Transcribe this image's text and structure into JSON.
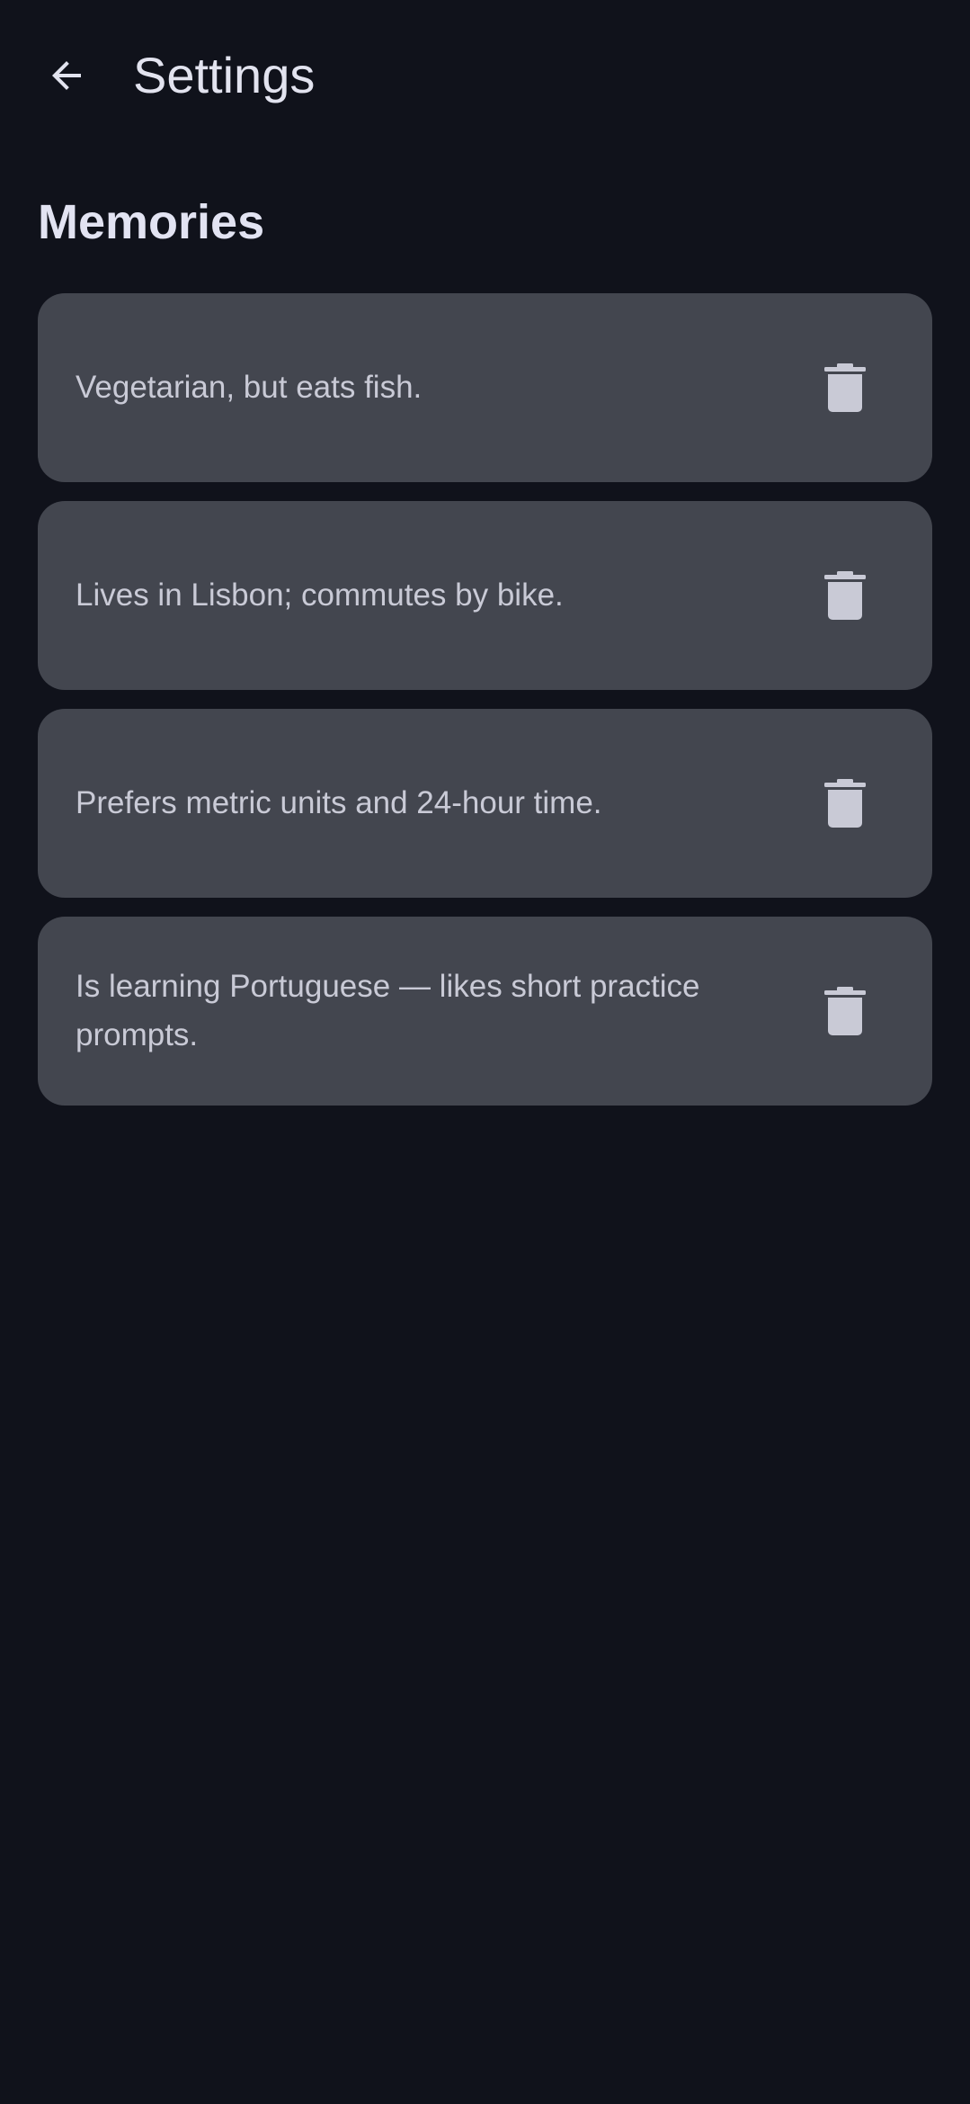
{
  "app_bar": {
    "title": "Settings",
    "back_icon": "arrow-left-icon"
  },
  "section": {
    "title": "Memories"
  },
  "memories": [
    {
      "text": "Vegetarian, but eats fish.",
      "action_icon": "trash-icon"
    },
    {
      "text": "Lives in Lisbon; commutes by bike.",
      "action_icon": "trash-icon"
    },
    {
      "text": "Prefers metric units and 24-hour time.",
      "action_icon": "trash-icon"
    },
    {
      "text": "Is learning Portuguese — likes short practice prompts.",
      "action_icon": "trash-icon"
    }
  ],
  "colors": {
    "background": "#10121b",
    "card": "#43464f",
    "text_primary": "#e2e3ef",
    "text_secondary": "#c9cad6",
    "icon": "#c9cad6"
  }
}
